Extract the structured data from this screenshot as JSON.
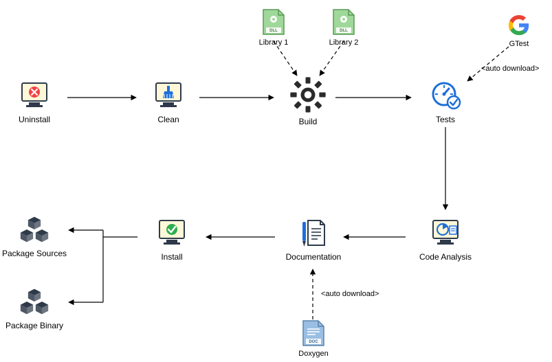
{
  "nodes": {
    "uninstall": "Uninstall",
    "clean": "Clean",
    "build": "Build",
    "tests": "Tests",
    "code_analysis": "Code Analysis",
    "documentation": "Documentation",
    "install": "Install",
    "package_sources": "Package Sources",
    "package_binary": "Package Binary",
    "library1": "Library 1",
    "library2": "Library 2",
    "gtest": "GTest",
    "doxygen": "Doxygen"
  },
  "annotations": {
    "auto_download_gtest": "<auto download>",
    "auto_download_doxygen": "<auto download>"
  }
}
